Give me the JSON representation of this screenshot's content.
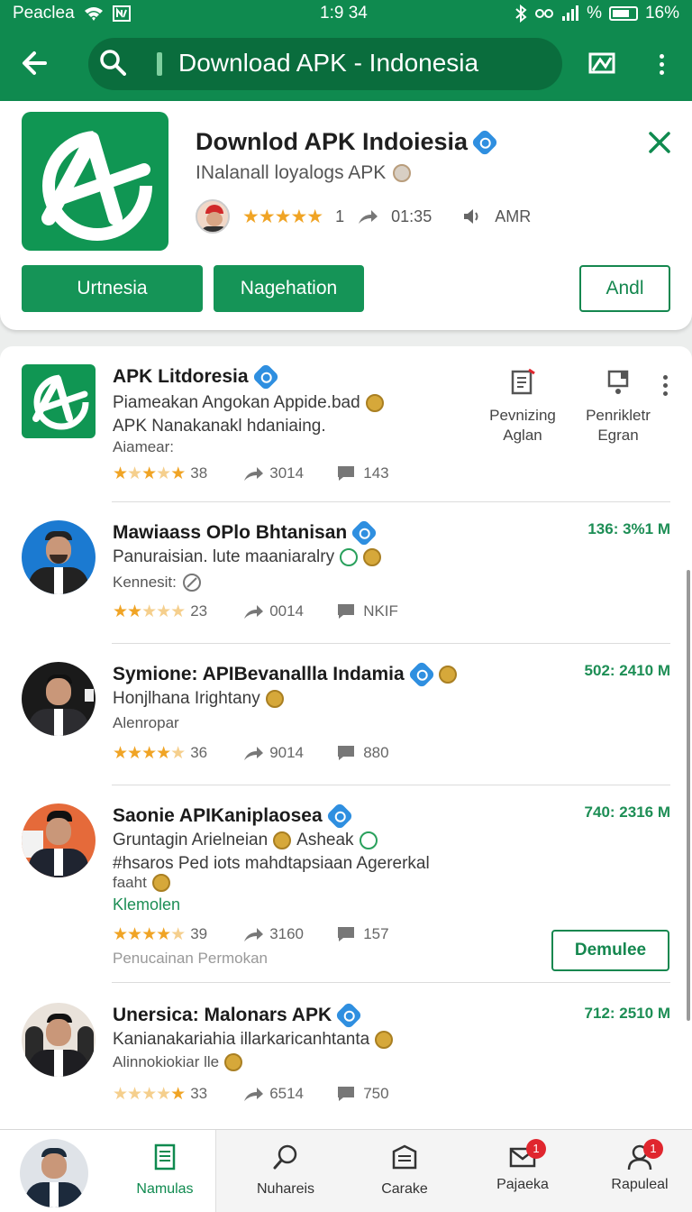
{
  "status_bar": {
    "carrier": "Peaclea",
    "time": "1:9 34",
    "battery": "16%"
  },
  "app_bar": {
    "search_query": "Download APK - Indonesia"
  },
  "top_card": {
    "title": "Downlod APK Indoiesia",
    "subtitle": "INalanall loyalogs APK",
    "rating_count": "1",
    "stat1": "01:35",
    "stat2": "AMR",
    "buttons": {
      "primary1": "Urtnesia",
      "primary2": "Nagehation",
      "outline": "Andl"
    }
  },
  "list": {
    "items": [
      {
        "name": "APK Litdoresia",
        "line1": "Piameakan Angokan Appide.bad",
        "line2": "APK Nanakanakl hdaniaing.",
        "line3": "Aiamear:",
        "rating": "38",
        "downloads": "3014",
        "comments": "143",
        "action1": {
          "line1": "Pevnizing",
          "line2": "Aglan"
        },
        "action2": {
          "line1": "Penrikletr",
          "line2": "Egran"
        }
      },
      {
        "name": "Mawiaass OPlo Bhtanisan",
        "line1": "Panuraisian. lute maaniaralry",
        "line3": "Kennesit:",
        "rating": "23",
        "downloads": "0014",
        "comments": "NKIF",
        "size": "136: 3%1 M"
      },
      {
        "name": "Symione: APIBevanallla Indamia",
        "line1": "Honjlhana Irightany",
        "line3": "Alenropar",
        "rating": "36",
        "downloads": "9014",
        "comments": "880",
        "size": "502: 2410 M"
      },
      {
        "name": "Saonie APIKaniplaosea",
        "line1": "Gruntagin Arielneian",
        "line1b": "Asheak",
        "line2": "#hsaros Ped iots mahdtapsiaan Agererkal",
        "line2b": "faaht",
        "line3": "Klemolen",
        "rating": "39",
        "downloads": "3160",
        "comments": "157",
        "footer": "Penucainan Permokan",
        "size": "740: 2316 M",
        "button": "Demulee"
      },
      {
        "name": "Unersica: Malonars APK",
        "line1": "Kanianakariahia illarkaricanhtanta",
        "line3": "Alinnokiokiar lle",
        "rating": "33",
        "downloads": "6514",
        "comments": "750",
        "size": "712: 2510 M"
      }
    ]
  },
  "bottom_nav": {
    "items": [
      {
        "label": "Namulas"
      },
      {
        "label": "Nuhareis"
      },
      {
        "label": "Carake"
      },
      {
        "label": "Pajaeka",
        "badge": "1"
      },
      {
        "label": "Rapuleal",
        "badge": "1"
      }
    ]
  },
  "colors": {
    "brand": "#0f8a4f",
    "star": "#f0a425",
    "verified": "#2f8fe0",
    "badge": "#e0262e"
  }
}
